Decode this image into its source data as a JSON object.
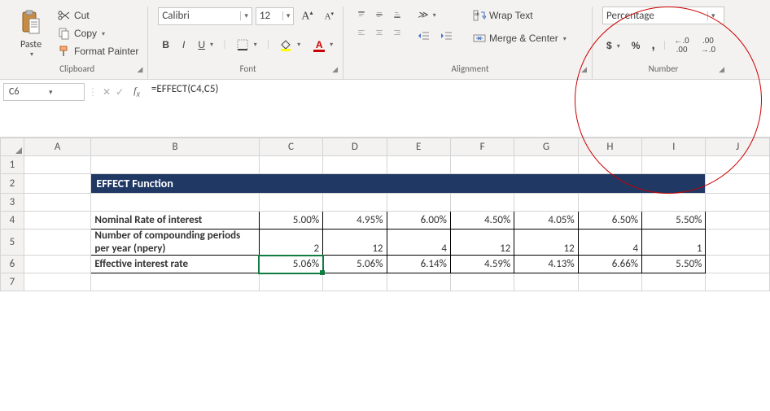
{
  "ribbon": {
    "clipboard": {
      "paste": "Paste",
      "cut": "Cut",
      "copy": "Copy",
      "painter": "Format Painter",
      "group": "Clipboard"
    },
    "font": {
      "name": "Calibri",
      "size": "12",
      "group": "Font"
    },
    "alignment": {
      "wrap": "Wrap Text",
      "merge": "Merge & Center",
      "group": "Alignment"
    },
    "number": {
      "format": "Percentage",
      "group": "Number"
    }
  },
  "formula_bar": {
    "cell": "C6",
    "formula": "=EFFECT(C4,C5)"
  },
  "columns": [
    "A",
    "B",
    "C",
    "D",
    "E",
    "F",
    "G",
    "H",
    "I",
    "J"
  ],
  "rows": [
    "1",
    "2",
    "3",
    "4",
    "5",
    "6",
    "7"
  ],
  "sheet": {
    "title": "EFFECT Function",
    "label_nominal": "Nominal Rate of interest",
    "label_periods": "Number of compounding periods per year (npery)",
    "label_effective": "Effective interest rate",
    "nominal": [
      "5.00%",
      "4.95%",
      "6.00%",
      "4.50%",
      "4.05%",
      "6.50%",
      "5.50%"
    ],
    "periods": [
      "2",
      "12",
      "4",
      "12",
      "12",
      "4",
      "1"
    ],
    "effective": [
      "5.06%",
      "5.06%",
      "6.14%",
      "4.59%",
      "4.13%",
      "6.66%",
      "5.50%"
    ]
  },
  "colors": {
    "banner": "#1f3864",
    "selection": "#107c41",
    "circle": "#c00000"
  },
  "chart_data": {
    "type": "table",
    "title": "EFFECT Function",
    "columns": [
      "Nominal Rate of interest",
      "Number of compounding periods per year (npery)",
      "Effective interest rate"
    ],
    "rows": [
      {
        "nominal": 0.05,
        "npery": 2,
        "effective": 0.0506
      },
      {
        "nominal": 0.0495,
        "npery": 12,
        "effective": 0.0506
      },
      {
        "nominal": 0.06,
        "npery": 4,
        "effective": 0.0614
      },
      {
        "nominal": 0.045,
        "npery": 12,
        "effective": 0.0459
      },
      {
        "nominal": 0.0405,
        "npery": 12,
        "effective": 0.0413
      },
      {
        "nominal": 0.065,
        "npery": 4,
        "effective": 0.0666
      },
      {
        "nominal": 0.055,
        "npery": 1,
        "effective": 0.055
      }
    ]
  }
}
